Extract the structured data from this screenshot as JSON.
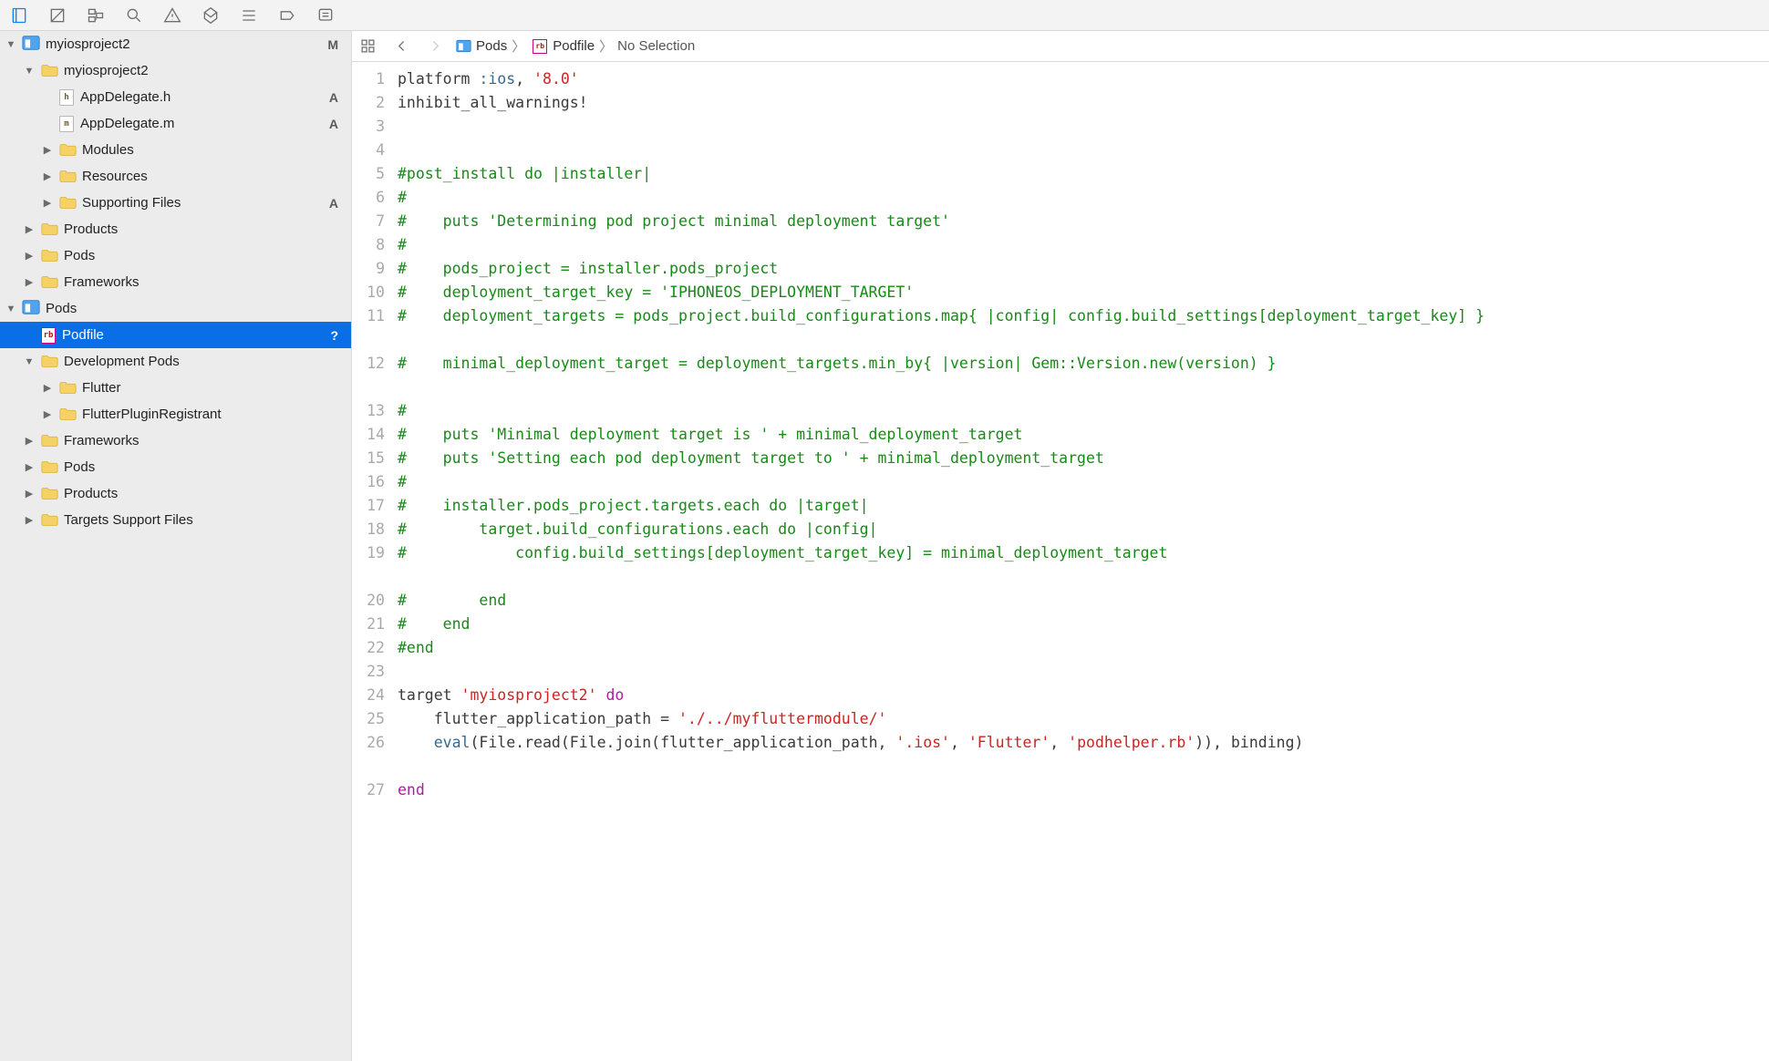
{
  "breadcrumbs": [
    "Pods",
    "Podfile",
    "No Selection"
  ],
  "tree": [
    {
      "depth": 0,
      "kind": "project",
      "label": "myiosproject2",
      "badge": "M",
      "disclosure": "open"
    },
    {
      "depth": 1,
      "kind": "folder",
      "label": "myiosproject2",
      "disclosure": "open"
    },
    {
      "depth": 2,
      "kind": "file",
      "ico": "h",
      "label": "AppDelegate.h",
      "badge": "A"
    },
    {
      "depth": 2,
      "kind": "file",
      "ico": "m",
      "label": "AppDelegate.m",
      "badge": "A"
    },
    {
      "depth": 2,
      "kind": "folder",
      "label": "Modules",
      "disclosure": "closed"
    },
    {
      "depth": 2,
      "kind": "folder",
      "label": "Resources",
      "disclosure": "closed"
    },
    {
      "depth": 2,
      "kind": "folder",
      "label": "Supporting Files",
      "badge": "A",
      "disclosure": "closed"
    },
    {
      "depth": 1,
      "kind": "folder",
      "label": "Products",
      "disclosure": "closed"
    },
    {
      "depth": 1,
      "kind": "folder",
      "label": "Pods",
      "disclosure": "closed"
    },
    {
      "depth": 1,
      "kind": "folder",
      "label": "Frameworks",
      "disclosure": "closed"
    },
    {
      "depth": 0,
      "kind": "project",
      "label": "Pods",
      "disclosure": "open"
    },
    {
      "depth": 1,
      "kind": "file",
      "ico": "rb",
      "label": "Podfile",
      "badge": "?",
      "selected": true
    },
    {
      "depth": 1,
      "kind": "folder",
      "label": "Development Pods",
      "disclosure": "open"
    },
    {
      "depth": 2,
      "kind": "folder",
      "label": "Flutter",
      "disclosure": "closed"
    },
    {
      "depth": 2,
      "kind": "folder",
      "label": "FlutterPluginRegistrant",
      "disclosure": "closed"
    },
    {
      "depth": 1,
      "kind": "folder",
      "label": "Frameworks",
      "disclosure": "closed"
    },
    {
      "depth": 1,
      "kind": "folder",
      "label": "Pods",
      "disclosure": "closed"
    },
    {
      "depth": 1,
      "kind": "folder",
      "label": "Products",
      "disclosure": "closed"
    },
    {
      "depth": 1,
      "kind": "folder",
      "label": "Targets Support Files",
      "disclosure": "closed"
    }
  ],
  "code": [
    {
      "n": 1,
      "t": [
        [
          "sym",
          "platform "
        ],
        [
          "fun",
          ":ios"
        ],
        [
          "sym",
          ", "
        ],
        [
          "str",
          "'8.0'"
        ]
      ]
    },
    {
      "n": 2,
      "t": [
        [
          "sym",
          "inhibit_all_warnings!"
        ]
      ]
    },
    {
      "n": 3,
      "t": [
        [
          "sym",
          ""
        ]
      ]
    },
    {
      "n": 4,
      "t": [
        [
          "sym",
          ""
        ]
      ]
    },
    {
      "n": 5,
      "t": [
        [
          "com",
          "#post_install do |installer|"
        ]
      ]
    },
    {
      "n": 6,
      "t": [
        [
          "com",
          "#"
        ]
      ]
    },
    {
      "n": 7,
      "t": [
        [
          "com",
          "#    puts 'Determining pod project minimal deployment target'"
        ]
      ]
    },
    {
      "n": 8,
      "t": [
        [
          "com",
          "#"
        ]
      ]
    },
    {
      "n": 9,
      "t": [
        [
          "com",
          "#    pods_project = installer.pods_project"
        ]
      ]
    },
    {
      "n": 10,
      "t": [
        [
          "com",
          "#    deployment_target_key = 'IPHONEOS_DEPLOYMENT_TARGET'"
        ]
      ]
    },
    {
      "n": 11,
      "double": true,
      "t": [
        [
          "com",
          "#    deployment_targets = pods_project.build_configurations.map{ |config| config.build_settings[deployment_target_key] }"
        ]
      ]
    },
    {
      "n": 12,
      "double": true,
      "t": [
        [
          "com",
          "#    minimal_deployment_target = deployment_targets.min_by{ |version| Gem::Version.new(version) }"
        ]
      ]
    },
    {
      "n": 13,
      "t": [
        [
          "com",
          "#"
        ]
      ]
    },
    {
      "n": 14,
      "t": [
        [
          "com",
          "#    puts 'Minimal deployment target is ' + minimal_deployment_target"
        ]
      ]
    },
    {
      "n": 15,
      "t": [
        [
          "com",
          "#    puts 'Setting each pod deployment target to ' + minimal_deployment_target"
        ]
      ]
    },
    {
      "n": 16,
      "t": [
        [
          "com",
          "#"
        ]
      ]
    },
    {
      "n": 17,
      "t": [
        [
          "com",
          "#    installer.pods_project.targets.each do |target|"
        ]
      ]
    },
    {
      "n": 18,
      "t": [
        [
          "com",
          "#        target.build_configurations.each do |config|"
        ]
      ]
    },
    {
      "n": 19,
      "double": true,
      "t": [
        [
          "com",
          "#            config.build_settings[deployment_target_key] = minimal_deployment_target"
        ]
      ]
    },
    {
      "n": 20,
      "t": [
        [
          "com",
          "#        end"
        ]
      ]
    },
    {
      "n": 21,
      "t": [
        [
          "com",
          "#    end"
        ]
      ]
    },
    {
      "n": 22,
      "t": [
        [
          "com",
          "#end"
        ]
      ]
    },
    {
      "n": 23,
      "t": [
        [
          "sym",
          ""
        ]
      ]
    },
    {
      "n": 24,
      "t": [
        [
          "sym",
          "target "
        ],
        [
          "str",
          "'myiosproject2'"
        ],
        [
          "sym",
          " "
        ],
        [
          "kw",
          "do"
        ]
      ]
    },
    {
      "n": 25,
      "t": [
        [
          "sym",
          "    flutter_application_path = "
        ],
        [
          "str",
          "'./../myfluttermodule/'"
        ]
      ]
    },
    {
      "n": 26,
      "double": true,
      "t": [
        [
          "sym",
          "    "
        ],
        [
          "fun",
          "eval"
        ],
        [
          "sym",
          "(File.read(File.join(flutter_application_path, "
        ],
        [
          "str",
          "'.ios'"
        ],
        [
          "sym",
          ", "
        ],
        [
          "str",
          "'Flutter'"
        ],
        [
          "sym",
          ", "
        ],
        [
          "str",
          "'podhelper.rb'"
        ],
        [
          "sym",
          ")), binding)"
        ]
      ]
    },
    {
      "n": 27,
      "t": [
        [
          "kw",
          "end"
        ]
      ]
    }
  ]
}
